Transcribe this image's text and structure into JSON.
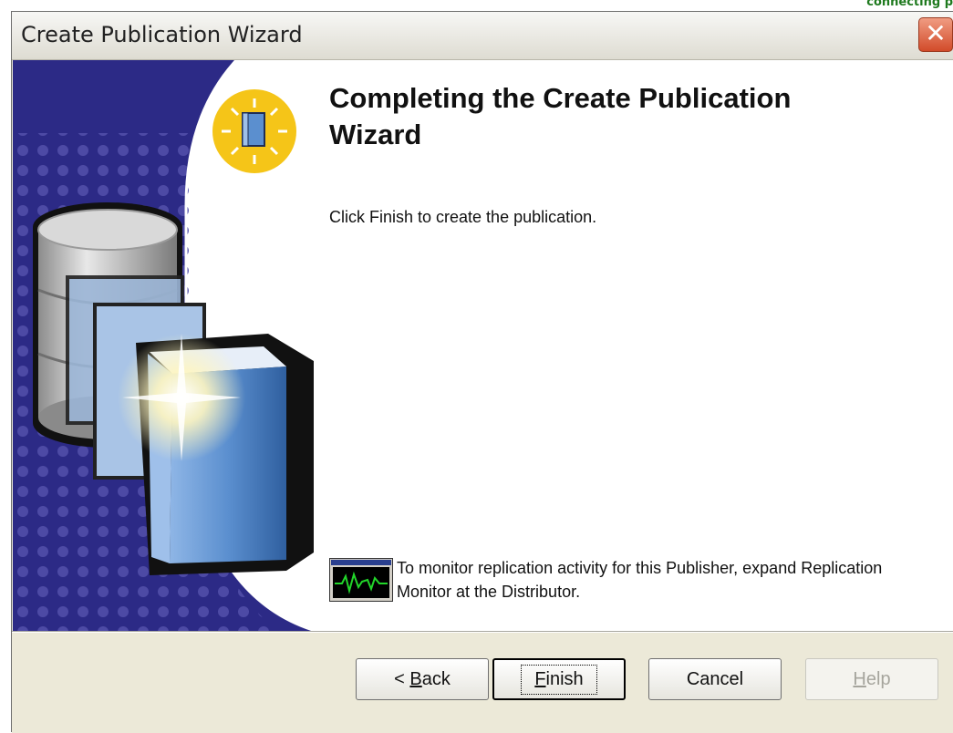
{
  "corner_text": "connecting p",
  "window": {
    "title": "Create Publication Wizard",
    "close_label": "✕"
  },
  "page": {
    "heading": "Completing the Create Publication Wizard",
    "intro": "Click Finish to create the publication.",
    "monitor_note": "To monitor replication activity for this Publisher, expand Replication Monitor at the Distributor."
  },
  "buttons": {
    "back": {
      "prefix": "< ",
      "mnemonic": "B",
      "rest": "ack",
      "enabled": true
    },
    "finish": {
      "mnemonic": "F",
      "rest": "inish",
      "enabled": true,
      "default": true
    },
    "cancel": {
      "label": "Cancel",
      "enabled": true
    },
    "help": {
      "mnemonic": "H",
      "rest": "elp",
      "enabled": false
    }
  },
  "colors": {
    "art_navy": "#2c2a86",
    "book_blue": "#5b8fcf",
    "bulb_yellow": "#f5c518",
    "titlebar_text": "#222222"
  },
  "icons": [
    "lightbulb-book-icon",
    "database-book-illustration",
    "replication-monitor-icon",
    "close-icon"
  ]
}
